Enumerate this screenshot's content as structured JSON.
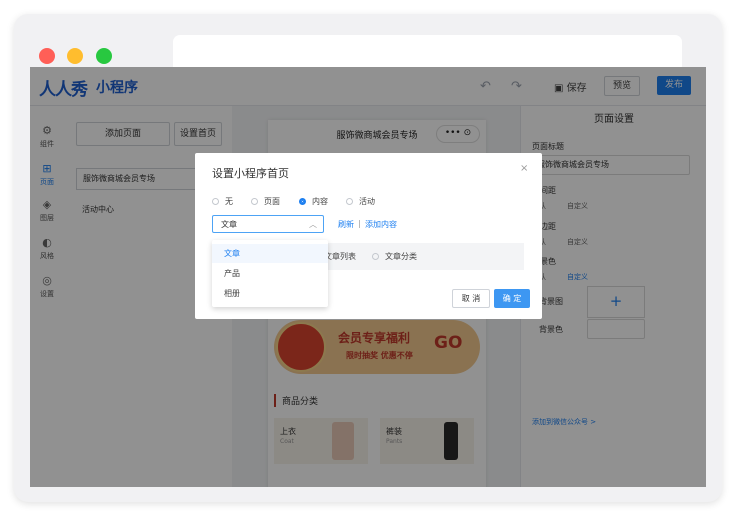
{
  "colors": {
    "primary": "#1d7ff0",
    "close": "#ff5f57",
    "minimize": "#ffbd2e",
    "zoom": "#28c840"
  },
  "window": {
    "controls": [
      "close",
      "minimize",
      "zoom"
    ]
  },
  "header": {
    "logo": "人人秀",
    "product": "小程序",
    "undo_icon": "undo-icon",
    "redo_icon": "redo-icon",
    "save_label": "保存",
    "preview_label": "预览",
    "publish_label": "发布"
  },
  "rail": {
    "items": [
      {
        "label": "组件",
        "icon": "puzzle-icon"
      },
      {
        "label": "页面",
        "icon": "page-icon",
        "active": true
      },
      {
        "label": "图层",
        "icon": "layers-icon"
      },
      {
        "label": "风格",
        "icon": "palette-icon"
      },
      {
        "label": "设置",
        "icon": "gear-icon"
      }
    ]
  },
  "pages_panel": {
    "add_page": "添加页面",
    "set_home": "设置首页",
    "pages": [
      {
        "label": "服饰微商城会员专场",
        "selected": true
      },
      {
        "label": "活动中心",
        "selected": false
      }
    ]
  },
  "phone": {
    "title": "服饰微商城会员专场",
    "capsule_dots": "•••",
    "capsule_close": "⊙",
    "banner": {
      "title": "会员专享福利",
      "subtitle": "限时抽奖 优惠不停",
      "cta": "GO"
    },
    "category_title": "商品分类",
    "products": [
      {
        "name": "上衣",
        "en": "Coat"
      },
      {
        "name": "裤装",
        "en": "Pants"
      }
    ]
  },
  "right_panel": {
    "title": "页面设置",
    "page_title_label": "页面标题",
    "page_title_value": "服饰微商城会员专场",
    "block_spacing_label": "块间距",
    "page_margin_label": "页边距",
    "bg_color_label": "背景色",
    "opt_default": "默认",
    "opt_custom": "自定义",
    "bg_image_label": "背景图",
    "bg_color2_label": "背景色",
    "add_official_link": "添加到微信公众号 >"
  },
  "modal": {
    "title": "设置小程序首页",
    "close_label": "×",
    "options": [
      {
        "label": "无",
        "checked": false
      },
      {
        "label": "页面",
        "checked": false
      },
      {
        "label": "内容",
        "checked": true
      },
      {
        "label": "活动",
        "checked": false
      }
    ],
    "select_value": "文章",
    "refresh_label": "刷新",
    "separator": "|",
    "add_content_label": "添加内容",
    "sub_options": [
      "文章列表",
      "文章分类"
    ],
    "cancel_label": "取 消",
    "ok_label": "确 定"
  },
  "dropdown": {
    "items": [
      {
        "label": "文章",
        "active": true
      },
      {
        "label": "产品",
        "active": false
      },
      {
        "label": "相册",
        "active": false
      }
    ]
  }
}
